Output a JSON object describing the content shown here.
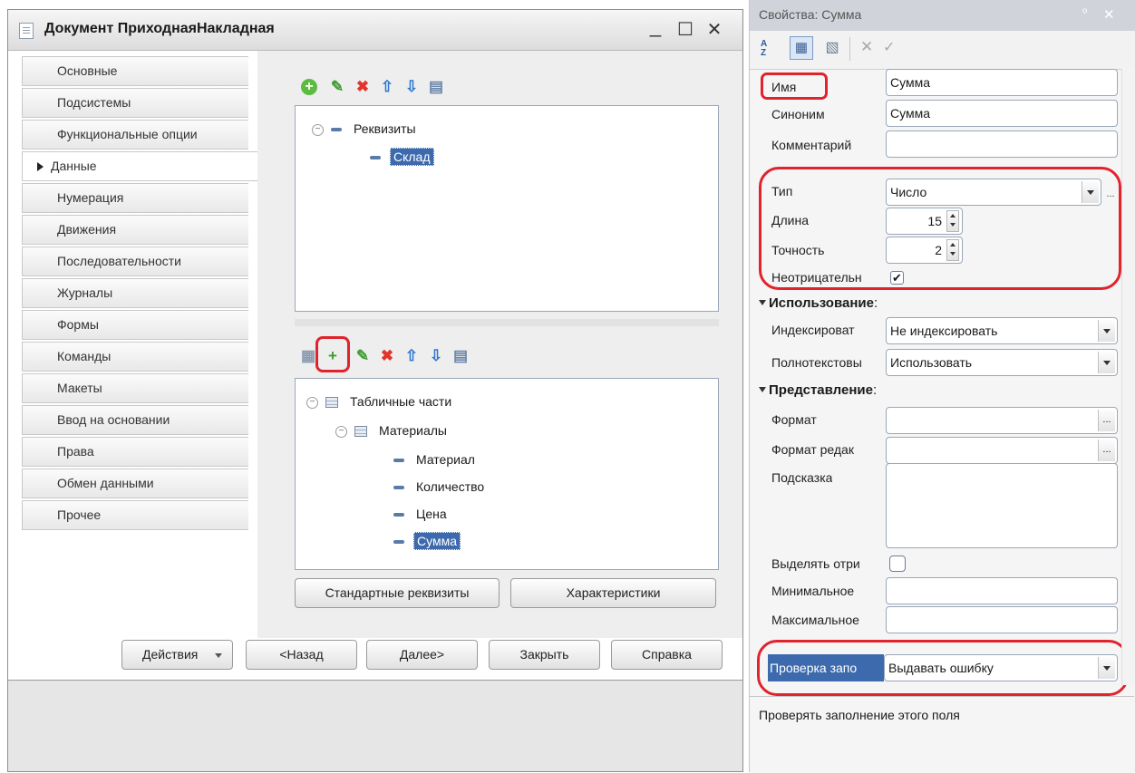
{
  "window": {
    "title": "Документ ПриходнаяНакладная",
    "minimize": "_",
    "maximize": "☐",
    "close": "✕"
  },
  "nav": {
    "tabs": [
      "Основные",
      "Подсистемы",
      "Функциональные опции",
      "Данные",
      "Нумерация",
      "Движения",
      "Последовательности",
      "Журналы",
      "Формы",
      "Команды",
      "Макеты",
      "Ввод на основании",
      "Права",
      "Обмен данными",
      "Прочее"
    ],
    "active": "Данные"
  },
  "requisites": {
    "root": "Реквизиты",
    "items": [
      "Склад"
    ]
  },
  "tabular": {
    "root": "Табличные части",
    "part": "Материалы",
    "items": [
      "Материал",
      "Количество",
      "Цена",
      "Сумма"
    ]
  },
  "buttons": {
    "standard": "Стандартные реквизиты",
    "characteristics": "Характеристики",
    "actions": "Действия",
    "back": "<Назад",
    "next": "Далее>",
    "close": "Закрыть",
    "help": "Справка"
  },
  "props": {
    "title": "Свойства: Сумма",
    "pin": "ᵒ",
    "close": "✕",
    "name_label": "Имя",
    "name_value": "Сумма",
    "synonym_label": "Синоним",
    "synonym_value": "Сумма",
    "comment_label": "Комментарий",
    "comment_value": "",
    "type_label": "Тип",
    "type_value": "Число",
    "length_label": "Длина",
    "length_value": "15",
    "precision_label": "Точность",
    "precision_value": "2",
    "nonneg_label": "Неотрицательн",
    "nonneg_checked": "✔",
    "section_usage": "Использование",
    "index_label": "Индексироват",
    "index_value": "Не индексировать",
    "fulltext_label": "Полнотекстовы",
    "fulltext_value": "Использовать",
    "section_view": "Представление",
    "format_label": "Формат",
    "format_edit_label": "Формат редак",
    "hint_label": "Подсказка",
    "highlight_label": "Выделять отри",
    "min_label": "Минимальное",
    "max_label": "Максимальное",
    "fill_check_label": "Проверка запо",
    "fill_check_value": "Выдавать ошибку",
    "description": "Проверять заполнение этого поля"
  },
  "colors": {
    "accent": "#3d6aad",
    "highlight_oval": "#e0232d"
  }
}
